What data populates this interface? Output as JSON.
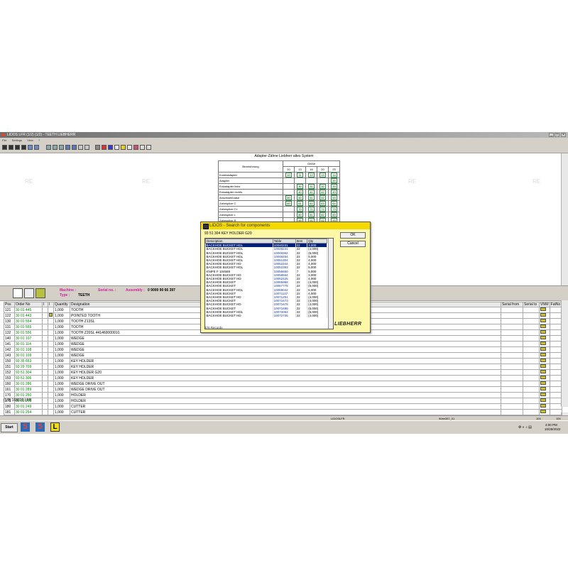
{
  "window": {
    "title": "LIDOS LFR (1/2) (1/2) - TEETH LIEBHERR",
    "menu": [
      "File",
      "Settings",
      "View",
      "?"
    ]
  },
  "toolbar": {
    "icons": [
      "first-icon",
      "prev-icon",
      "next-icon",
      "last-icon",
      "open-icon",
      "save-icon",
      "zoom-in-icon",
      "zoom-out-icon",
      "zoom-fit-icon",
      "search-icon",
      "find-icon",
      "link-icon",
      "copy-icon",
      "print-icon",
      "stop-icon",
      "grid-icon",
      "ref-icon",
      "info-icon",
      "help-icon",
      "cart-icon",
      "settings-icon",
      "mail-icon"
    ]
  },
  "drawing": {
    "table_title": "Adapter-Zähne Liebherr altes System",
    "col_header": "Bezeichnung",
    "size_header": "Größe",
    "sizes": [
      "10",
      "13",
      "16",
      "20",
      "25"
    ],
    "rows": [
      {
        "name": "Kombiadapter",
        "cells": [
          "10",
          "11",
          "12",
          "13",
          "14"
        ]
      },
      {
        "name": "Adapter",
        "cells": [
          "",
          "",
          "",
          "",
          "20"
        ]
      },
      {
        "name": "Eckadapter links",
        "cells": [
          "",
          "30",
          "31",
          "32",
          "33"
        ]
      },
      {
        "name": "Eckadapter rechts",
        "cells": [
          "",
          "40",
          "41",
          "42",
          "43"
        ]
      },
      {
        "name": "Anschweißnase",
        "cells": [
          "50",
          "50",
          "51",
          "52",
          "53"
        ]
      },
      {
        "name": "Zahnspitze C",
        "cells": [
          "60",
          "61",
          "62",
          "63",
          "64"
        ]
      },
      {
        "name": "Zahnspitze CL",
        "cells": [
          "",
          "70",
          "71",
          "72",
          "73"
        ]
      },
      {
        "name": "Zahnspitze L",
        "cells": [
          "",
          "80",
          "81",
          "82",
          "83"
        ]
      },
      {
        "name": "Zahnspitze R",
        "cells": [
          "",
          "90",
          "91",
          "92",
          "93"
        ]
      }
    ],
    "watermark": "RE"
  },
  "info": {
    "machine_label": "Machine :",
    "type_label": "Type :",
    "type_value": "TEETH",
    "serial_label": "Serial no. :",
    "assembly_label": "Assembly :",
    "assembly_value": "0 9000 90 66 397"
  },
  "parts": {
    "headers": {
      "pos": "Pos",
      "order": "Order No",
      "i1": "I",
      "i2": "I",
      "qty": "Quantity",
      "desig": "Designation",
      "serial_from": "Serial from",
      "serial_to": "Serial to",
      "vnw": "VNW",
      "fatno": "FatNo"
    },
    "rows": [
      {
        "pos": "121",
        "order": "30 01 445",
        "qty": "1,000",
        "desig": "TOOTH"
      },
      {
        "pos": "122",
        "order": "30 01 443",
        "qty": "1,000",
        "desig": "POINTED TOOTH"
      },
      {
        "pos": "130",
        "order": "30 01 554",
        "qty": "1,000",
        "desig": "TOOTH Z13SL"
      },
      {
        "pos": "131",
        "order": "30 01 555",
        "qty": "1,000",
        "desig": "TOOTH"
      },
      {
        "pos": "132",
        "order": "30 01 556",
        "qty": "1,000",
        "desig": "TOOTH Z20SL 441460000010."
      },
      {
        "pos": "140",
        "order": "30 01 107",
        "qty": "1,000",
        "desig": "WEDGE"
      },
      {
        "pos": "141",
        "order": "30 01 114",
        "qty": "1,000",
        "desig": "WEDGE"
      },
      {
        "pos": "142",
        "order": "30 01 108",
        "qty": "1,000",
        "desig": "WEDGE"
      },
      {
        "pos": "143",
        "order": "30 01 109",
        "qty": "1,000",
        "desig": "WEDGE"
      },
      {
        "pos": "150",
        "order": "93 35 653",
        "qty": "1,000",
        "desig": "KEY HOLDER"
      },
      {
        "pos": "151",
        "order": "93 29 709",
        "qty": "1,000",
        "desig": "KEY HOLDER"
      },
      {
        "pos": "152",
        "order": "93 51 304",
        "qty": "1,000",
        "desig": "KEY HOLDER G20"
      },
      {
        "pos": "153",
        "order": "93 51 306",
        "qty": "1,000",
        "desig": "KEY HOLDER"
      },
      {
        "pos": "160",
        "order": "30 01 286",
        "qty": "1,000",
        "desig": "WEDGE DRIVE OUT"
      },
      {
        "pos": "161",
        "order": "30 01 289",
        "qty": "1,000",
        "desig": "WEDGE DRIVE OUT"
      },
      {
        "pos": "170",
        "order": "30 01 250",
        "qty": "1,000",
        "desig": "HOLDER"
      },
      {
        "pos": "171",
        "order": "30 01 253",
        "qty": "1,000",
        "desig": "HOLDER"
      },
      {
        "pos": "180",
        "order": "30 01 249",
        "qty": "1,000",
        "desig": "CUTTER"
      },
      {
        "pos": "181",
        "order": "30 01 254",
        "qty": "1,000",
        "desig": "CUTTER"
      }
    ],
    "footer": "(1/3) 168016 LFR"
  },
  "status": {
    "center": "LIDOSLFR",
    "right": "90ee397_01",
    "panel1": "100",
    "panel2": "100"
  },
  "taskbar": {
    "start": "Start",
    "time": "4:00 PM",
    "date": "10/28/2022"
  },
  "dialog": {
    "title": "LIDOS - Search for components",
    "subtitle": "93 51 304 KEY HOLDER G20",
    "headers": {
      "desc": "Description",
      "table": "Table",
      "item": "Item",
      "qty": "Qty"
    },
    "ok": "OK",
    "cancel": "Cancel",
    "records": "376 Records",
    "logo": "LIEBHERR",
    "rows": [
      {
        "desc": "BACKHOE BUCKET HDL",
        "table": "10040231",
        "item": "22",
        "qty": "3,000"
      },
      {
        "desc": "BACKHOE BUCKET HDL",
        "table": "10048231",
        "item": "22",
        "qty": "(4,000)"
      },
      {
        "desc": "BACKHOE BUCKET HDL",
        "table": "10048364",
        "item": "22",
        "qty": "(5,000)"
      },
      {
        "desc": "BACKHOE BUCKET HDL",
        "table": "10048454",
        "item": "22",
        "qty": "5,000"
      },
      {
        "desc": "BACKHOE BUCKET HDL",
        "table": "10051304",
        "item": "22",
        "qty": "4,000"
      },
      {
        "desc": "BACKHOE BUCKET HD",
        "table": "10052344",
        "item": "22",
        "qty": "4,000"
      },
      {
        "desc": "BACKHOE BUCKET HDL",
        "table": "10052393",
        "item": "22",
        "qty": "5,000"
      },
      {
        "desc": "KNIFE F  104569",
        "table": "10056660",
        "item": "7",
        "qty": "5,000"
      },
      {
        "desc": "BACKHOE BUCKET HD",
        "table": "10058564",
        "item": "22",
        "qty": "3,000"
      },
      {
        "desc": "BACKHOE BUCKET HD",
        "table": "10062425",
        "item": "22",
        "qty": "4,000"
      },
      {
        "desc": "BACKHOE BUCKET",
        "table": "10065968",
        "item": "22",
        "qty": "(4,000)"
      },
      {
        "desc": "BACKHOE BUCKET",
        "table": "10067778",
        "item": "22",
        "qty": "(5,000)"
      },
      {
        "desc": "BACKHOE BUCKET HDL",
        "table": "10068042",
        "item": "22",
        "qty": "5,000"
      },
      {
        "desc": "BACKHOE BUCKET",
        "table": "10071137",
        "item": "22",
        "qty": "4,000"
      },
      {
        "desc": "BACKHOE BUCKET HD",
        "table": "10071251",
        "item": "22",
        "qty": "(4,000)"
      },
      {
        "desc": "BACKHOE BUCKET",
        "table": "10071673",
        "item": "22",
        "qty": "(4,000)"
      },
      {
        "desc": "BACKHOE BUCKET HD",
        "table": "10071678",
        "item": "22",
        "qty": "(4,000)"
      },
      {
        "desc": "BACKHOE BUCKET",
        "table": "10071699",
        "item": "22",
        "qty": "(5,000)"
      },
      {
        "desc": "BACKHOE BUCKET HDL",
        "table": "10072063",
        "item": "22",
        "qty": "(5,000)"
      },
      {
        "desc": "BACKHOE BUCKET HD",
        "table": "10072735",
        "item": "22",
        "qty": "(4,000)"
      }
    ]
  }
}
